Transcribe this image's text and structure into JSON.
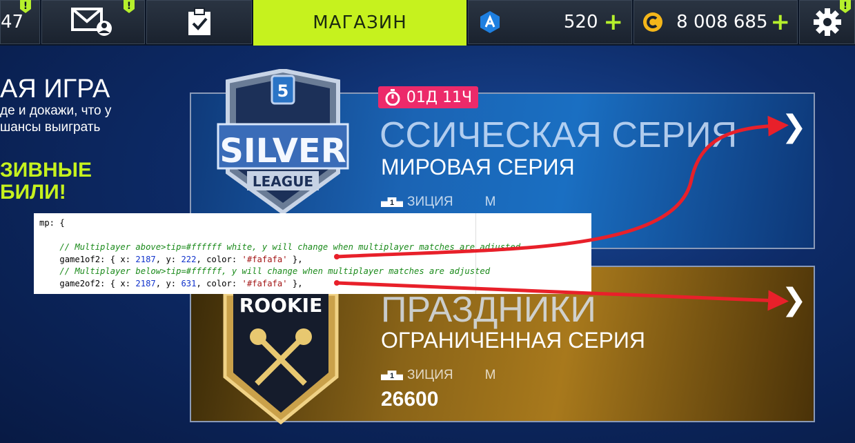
{
  "topbar": {
    "partial_count": "47",
    "alert_mark": "!",
    "shop_tab": "МАГАЗИН",
    "tokens": "520",
    "credits": "8 008 685",
    "plus": "+"
  },
  "left_panel": {
    "title": "АЯ ИГРА",
    "line1": "де и докажи, что у",
    "line2": "шансы выиграть",
    "green1": "ЗИВНЫЕ",
    "green2": "БИЛИ!"
  },
  "timer": {
    "label": "01Д 11Ч"
  },
  "cards": [
    {
      "badge_top": "SILVER",
      "badge_bottom": "LEAGUE",
      "badge_number": "5",
      "title": "ССИЧЕСКАЯ СЕРИЯ",
      "subtitle": "МИРОВАЯ СЕРИЯ",
      "meta_rank": "1",
      "meta_label": "ЗИЦИЯ",
      "meta_extra": "М"
    },
    {
      "badge_top": "ROOKIE",
      "title": "ПРАЗДНИКИ",
      "subtitle": "ОГРАНИЧЕННАЯ СЕРИЯ",
      "meta_rank": "1",
      "meta_label": "ЗИЦИЯ",
      "meta_extra": "М",
      "points": "26600"
    }
  ],
  "code": {
    "line1": "mp: {",
    "c1": "// Multiplayer above>tip=#ffffff white, y will change when multiplayer matches are adjusted",
    "k1": "game1of2: { x: ",
    "x1": "2187",
    "m1": ", y: ",
    "y1": "222",
    "n1": ", color: ",
    "col1": "'#fafafa'",
    "e1": " },",
    "c2": "// Multiplayer below>tip=#ffffff, y will change when multiplayer matches are adjusted",
    "k2": "game2of2: { x: ",
    "x2": "2187",
    "m2": ", y: ",
    "y2": "631",
    "n2": ", color: ",
    "col2": "'#fafafa'",
    "e2": " },"
  },
  "colors": {
    "accent_green": "#c6f21e",
    "timer_pink": "#ec2a6a",
    "arrow_red": "#e8202a"
  }
}
